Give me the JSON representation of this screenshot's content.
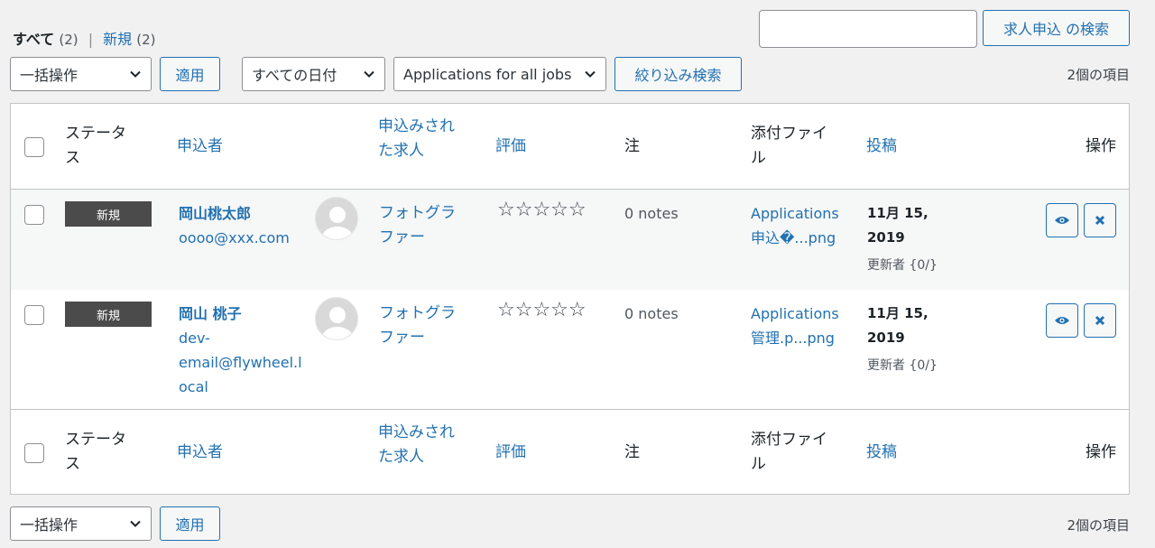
{
  "views": {
    "all_label": "すべて",
    "all_count": "(2)",
    "separator": "|",
    "new_label": "新規",
    "new_count": "(2)"
  },
  "search": {
    "placeholder": "",
    "value": "",
    "button_label": "求人申込 の検索"
  },
  "top_nav": {
    "bulk_select": "一括操作",
    "apply_label": "適用",
    "date_select": "すべての日付",
    "job_select": "Applications for all jobs",
    "filter_label": "絞り込み検索",
    "item_count": "2個の項目"
  },
  "columns": {
    "status_l1": "ステータ",
    "status_l2": "ス",
    "applicant": "申込者",
    "job_l1": "申込みされ",
    "job_l2": "た求人",
    "rating": "評価",
    "notes": "注",
    "attach_l1": "添付ファイ",
    "attach_l2": "ル",
    "posted": "投稿",
    "actions": "操作"
  },
  "rows": [
    {
      "status": "新規",
      "name": "岡山桃太郎",
      "email_l1": "oooo@xxx.com",
      "job_l1": "フォトグラ",
      "job_l2": "ファー",
      "stars": "☆☆☆☆☆",
      "notes": "0 notes",
      "attach_l1": "Applications",
      "attach_l2": "申込�...png",
      "date_l1": "11月 15,",
      "date_l2": "2019",
      "updated": "更新者 {0/}"
    },
    {
      "status": "新規",
      "name": "岡山 桃子",
      "email_l1": "dev-",
      "email_l2": "email@flywheel.l",
      "email_l3": "ocal",
      "job_l1": "フォトグラ",
      "job_l2": "ファー",
      "stars": "☆☆☆☆☆",
      "notes": "0 notes",
      "attach_l1": "Applications",
      "attach_l2": "管理.p...png",
      "date_l1": "11月 15,",
      "date_l2": "2019",
      "updated": "更新者 {0/}"
    }
  ],
  "bottom_nav": {
    "bulk_select": "一括操作",
    "apply_label": "適用",
    "item_count": "2個の項目"
  },
  "icons": {
    "view": "eye-icon",
    "delete": "close-icon",
    "avatar": "user-avatar-icon",
    "dropdown": "chevron-down-icon"
  },
  "colors": {
    "accent": "#2271b1",
    "badge": "#4b4b4b",
    "background": "#f1f1f1"
  }
}
